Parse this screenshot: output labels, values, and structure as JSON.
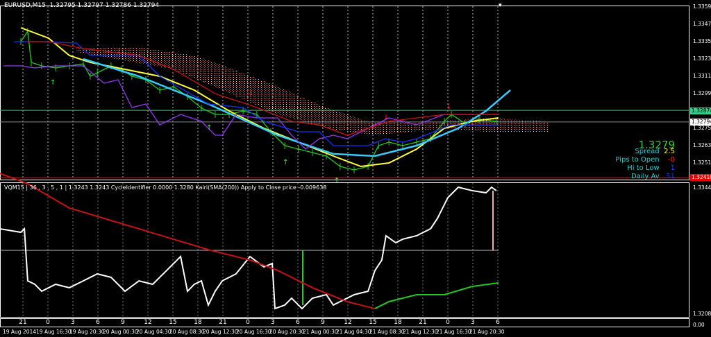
{
  "header": {
    "symbol_tf": "EURUSD,M15",
    "open": "1.32795",
    "high": "1.32797",
    "low": "1.32786",
    "close": "1.32794"
  },
  "subwindow": {
    "title": "VQM15 | 36 , 3 , 5 , 1  |  1.3243 1.3243  CycleIdentifier 0.0000 1.3280  Kairi(SMA(200)) Apply to Close price -0.009638"
  },
  "price_scale": [
    "1.33590",
    "1.33470",
    "1.33350",
    "1.33230",
    "1.33110",
    "1.32990",
    "1.32750",
    "1.32630",
    "1.32510"
  ],
  "price_labels": {
    "green_line": "1.32874",
    "bid": "1.32794",
    "red_line": "1.32410"
  },
  "sub_scale": {
    "top": "1.3344",
    "bottom": "1.3208"
  },
  "bottom_scale": "0.00",
  "info_panel": {
    "price": "1.3279",
    "rows": [
      {
        "label": "Spread",
        "value": "2.5",
        "color": "#ffff33"
      },
      {
        "label": "Pips to Open",
        "value": "-0",
        "color": "#ff2222"
      },
      {
        "label": "Hi to Low",
        "value": "1",
        "color": "#2244ff"
      },
      {
        "label": "Daily Av",
        "value": "51",
        "color": "#2233cc"
      }
    ]
  },
  "hour_labels": [
    "21",
    "0",
    "3",
    "6",
    "9",
    "12",
    "15",
    "18",
    "21",
    "0",
    "3",
    "6",
    "9",
    "12",
    "15",
    "18",
    "21",
    "0",
    "3",
    "6"
  ],
  "date_labels": [
    "19 Aug 2014",
    "19 Aug 16:30",
    "19 Aug 20:30",
    "20 Aug 00:30",
    "20 Aug 04:30",
    "20 Aug 08:30",
    "20 Aug 12:30",
    "20 Aug 16:30",
    "20 Aug 20:30",
    "21 Aug 00:30",
    "21 Aug 04:30",
    "21 Aug 08:30",
    "21 Aug 12:30",
    "21 Aug 16:30",
    "21 Aug 20:30"
  ],
  "chart_data": {
    "type": "line",
    "price_range": [
      1.3238,
      1.336
    ],
    "horizontal_levels": [
      {
        "name": "green-level",
        "price": 1.32874,
        "color": "#33cc66"
      },
      {
        "name": "bid-level",
        "price": 1.32794,
        "color": "#888888"
      },
      {
        "name": "red-level",
        "price": 1.3241,
        "color": "#ff0000"
      }
    ],
    "series": [
      {
        "name": "price",
        "color": "#22cc22",
        "points": [
          [
            10,
            1.3335
          ],
          [
            13.3,
            1.33422
          ],
          [
            15,
            1.33206
          ],
          [
            20,
            1.33182
          ],
          [
            26.7,
            1.33168
          ],
          [
            33.3,
            1.33182
          ],
          [
            40,
            1.33196
          ],
          [
            43.3,
            1.3311
          ],
          [
            46.7,
            1.33134
          ],
          [
            53.3,
            1.33182
          ],
          [
            58.3,
            1.33158
          ],
          [
            63.3,
            1.3311
          ],
          [
            70,
            1.33086
          ],
          [
            76.7,
            1.33014
          ],
          [
            83.3,
            1.33038
          ],
          [
            90,
            1.3297
          ],
          [
            96.7,
            1.3289
          ],
          [
            103.3,
            1.32846
          ],
          [
            110,
            1.32846
          ],
          [
            116.7,
            1.3287
          ],
          [
            123.3,
            1.32846
          ],
          [
            130,
            1.32726
          ],
          [
            136.7,
            1.3263
          ],
          [
            143.3,
            1.32606
          ],
          [
            150,
            1.32582
          ],
          [
            156.7,
            1.32558
          ],
          [
            163.3,
            1.32486
          ],
          [
            170,
            1.32462
          ],
          [
            176.7,
            1.32486
          ],
          [
            181.7,
            1.3263
          ],
          [
            186.7,
            1.32654
          ],
          [
            193.3,
            1.3263
          ],
          [
            200,
            1.32654
          ],
          [
            206.7,
            1.32678
          ],
          [
            213.3,
            1.32798
          ],
          [
            216.7,
            1.32846
          ],
          [
            223.3,
            1.32784
          ],
          [
            230,
            1.32812
          ],
          [
            238.3,
            1.32798
          ]
        ]
      },
      {
        "name": "yellow-ma",
        "color": "#ffff33",
        "points": [
          [
            10,
            1.33446
          ],
          [
            23.3,
            1.33374
          ],
          [
            33.3,
            1.33254
          ],
          [
            43.3,
            1.33206
          ],
          [
            60,
            1.33158
          ],
          [
            76.7,
            1.3311
          ],
          [
            93.3,
            1.33014
          ],
          [
            110,
            1.3287
          ],
          [
            126.7,
            1.3275
          ],
          [
            143.3,
            1.32654
          ],
          [
            160,
            1.32558
          ],
          [
            173.3,
            1.32486
          ],
          [
            186.7,
            1.3251
          ],
          [
            200,
            1.32606
          ],
          [
            213.3,
            1.3275
          ],
          [
            226.7,
            1.32798
          ],
          [
            239.3,
            1.32822
          ]
        ]
      },
      {
        "name": "cyan-curve",
        "color": "#33ccff",
        "points": [
          [
            40,
            1.3323
          ],
          [
            66.7,
            1.3311
          ],
          [
            100,
            1.32918
          ],
          [
            133.3,
            1.32702
          ],
          [
            160,
            1.32573
          ],
          [
            180,
            1.32558
          ],
          [
            200,
            1.3263
          ],
          [
            220,
            1.3275
          ],
          [
            233.3,
            1.3287
          ],
          [
            245,
            1.33014
          ]
        ]
      },
      {
        "name": "purple-line",
        "color": "#9933ff",
        "points": [
          [
            1.7,
            1.33182
          ],
          [
            10,
            1.33182
          ],
          [
            16.7,
            1.33168
          ],
          [
            26.7,
            1.33182
          ],
          [
            40,
            1.33182
          ],
          [
            50,
            1.33062
          ],
          [
            56.7,
            1.33086
          ],
          [
            63.3,
            1.32894
          ],
          [
            70,
            1.32918
          ],
          [
            76.7,
            1.32774
          ],
          [
            86.7,
            1.32846
          ],
          [
            96.7,
            1.32798
          ],
          [
            103.3,
            1.32702
          ],
          [
            106.7,
            1.32702
          ],
          [
            113.3,
            1.32846
          ],
          [
            123.3,
            1.32822
          ],
          [
            133.3,
            1.32822
          ],
          [
            140,
            1.32702
          ],
          [
            146.7,
            1.32606
          ],
          [
            153.3,
            1.32678
          ],
          [
            160,
            1.32702
          ],
          [
            166.7,
            1.32678
          ],
          [
            176.7,
            1.3275
          ],
          [
            186.7,
            1.32822
          ],
          [
            200,
            1.32774
          ],
          [
            213.3,
            1.32846
          ],
          [
            226.7,
            1.32846
          ],
          [
            239.3,
            1.32846
          ]
        ]
      },
      {
        "name": "blue-line",
        "color": "#1133ff",
        "points": [
          [
            6.7,
            1.3335
          ],
          [
            20,
            1.3335
          ],
          [
            36.7,
            1.3334
          ],
          [
            43.3,
            1.33254
          ],
          [
            66.7,
            1.33254
          ],
          [
            76.7,
            1.3311
          ],
          [
            100,
            1.32918
          ],
          [
            116.7,
            1.32894
          ],
          [
            126.7,
            1.32798
          ],
          [
            143.3,
            1.32726
          ],
          [
            153.3,
            1.32726
          ],
          [
            160,
            1.3263
          ],
          [
            176.7,
            1.3263
          ],
          [
            185,
            1.32678
          ],
          [
            193.3,
            1.32654
          ],
          [
            200,
            1.32678
          ],
          [
            216.7,
            1.32774
          ],
          [
            239.3,
            1.32774
          ]
        ]
      },
      {
        "name": "red-line",
        "color": "#cc1111",
        "points": [
          [
            13.3,
            1.3335
          ],
          [
            23.3,
            1.3335
          ],
          [
            40,
            1.33302
          ],
          [
            66.7,
            1.33254
          ],
          [
            83.3,
            1.33158
          ],
          [
            103.3,
            1.3299
          ],
          [
            123.3,
            1.32894
          ],
          [
            140,
            1.32798
          ],
          [
            153.3,
            1.32774
          ],
          [
            166.7,
            1.32702
          ],
          [
            186.7,
            1.32798
          ],
          [
            213.3,
            1.32846
          ],
          [
            239.3,
            1.32846
          ]
        ]
      }
    ],
    "cloud": {
      "top": [
        [
          36.7,
          1.33302
        ],
        [
          66.7,
          1.33312
        ],
        [
          93.3,
          1.33254
        ],
        [
          116.7,
          1.33134
        ],
        [
          133.3,
          1.33038
        ],
        [
          156.7,
          1.32894
        ],
        [
          176.7,
          1.32798
        ],
        [
          200,
          1.32784
        ],
        [
          233.3,
          1.32822
        ],
        [
          263.3,
          1.32798
        ]
      ],
      "bottom": [
        [
          36.7,
          1.33278
        ],
        [
          83.3,
          1.33158
        ],
        [
          106.7,
          1.33014
        ],
        [
          133.3,
          1.32846
        ],
        [
          156.7,
          1.3275
        ],
        [
          180,
          1.32702
        ],
        [
          213.3,
          1.3275
        ],
        [
          233.3,
          1.32726
        ],
        [
          263.3,
          1.32726
        ]
      ]
    },
    "signals": [
      {
        "type": "up",
        "bar": 25,
        "price": 1.3311
      },
      {
        "type": "up",
        "bar": 100,
        "price": 1.32798
      },
      {
        "type": "up",
        "bar": 136.7,
        "price": 1.32558
      },
      {
        "type": "up",
        "bar": 161.3,
        "price": 1.3243
      },
      {
        "type": "down",
        "bar": 56.7,
        "price": 1.33254
      },
      {
        "type": "down",
        "bar": 120,
        "price": 1.32966
      },
      {
        "type": "down",
        "bar": 185,
        "price": 1.32798
      },
      {
        "type": "down",
        "bar": 215,
        "price": 1.3287
      }
    ],
    "sub": {
      "range": [
        1.3208,
        1.3344
      ],
      "level": 1.3276,
      "series": [
        {
          "name": "vqm-white",
          "color": "#ffffff",
          "points": [
            [
              0,
              1.32992
            ],
            [
              10,
              1.32954
            ],
            [
              11.7,
              1.32992
            ],
            [
              13.3,
              1.32431
            ],
            [
              16.7,
              1.32394
            ],
            [
              20,
              1.32319
            ],
            [
              26.7,
              1.32394
            ],
            [
              33.3,
              1.32357
            ],
            [
              40,
              1.32431
            ],
            [
              46.7,
              1.32506
            ],
            [
              53.3,
              1.32469
            ],
            [
              60,
              1.32319
            ],
            [
              66.7,
              1.32431
            ],
            [
              73.3,
              1.32394
            ],
            [
              80,
              1.32543
            ],
            [
              86.7,
              1.32693
            ],
            [
              90,
              1.32319
            ],
            [
              93.3,
              1.32394
            ],
            [
              96.7,
              1.32431
            ],
            [
              100,
              1.3217
            ],
            [
              103.3,
              1.32319
            ],
            [
              106.7,
              1.32431
            ],
            [
              113.3,
              1.32506
            ],
            [
              120,
              1.32693
            ],
            [
              126.7,
              1.32581
            ],
            [
              130.7,
              1.32618
            ],
            [
              132,
              1.32132
            ],
            [
              136.7,
              1.3217
            ],
            [
              140,
              1.32244
            ],
            [
              145,
              1.32132
            ],
            [
              146.7,
              1.3217
            ],
            [
              150,
              1.32244
            ],
            [
              156.7,
              1.32282
            ],
            [
              160,
              1.3217
            ],
            [
              163.3,
              1.32207
            ],
            [
              170,
              1.32282
            ],
            [
              176.7,
              1.32319
            ],
            [
              180,
              1.32543
            ],
            [
              183.3,
              1.32655
            ],
            [
              185.3,
              1.32917
            ],
            [
              190,
              1.32842
            ],
            [
              193.3,
              1.3288
            ],
            [
              200,
              1.32917
            ],
            [
              206.7,
              1.32992
            ],
            [
              210,
              1.33104
            ],
            [
              215,
              1.33328
            ],
            [
              220,
              1.3344
            ],
            [
              226.7,
              1.33403
            ],
            [
              233.3,
              1.3338
            ],
            [
              236,
              1.3344
            ],
            [
              238.3,
              1.33403
            ]
          ]
        },
        {
          "name": "cycle-red",
          "color": "#cc1111",
          "points": [
            [
              0,
              1.33589
            ],
            [
              13.3,
              1.33477
            ],
            [
              33.3,
              1.33216
            ],
            [
              66.7,
              1.32992
            ],
            [
              100,
              1.32767
            ],
            [
              120,
              1.32655
            ],
            [
              133.3,
              1.32543
            ],
            [
              150,
              1.32357
            ],
            [
              166.7,
              1.32207
            ],
            [
              180,
              1.32132
            ]
          ]
        },
        {
          "name": "cycle-green",
          "color": "#22cc22",
          "points": [
            [
              180,
              1.32132
            ],
            [
              186.7,
              1.32207
            ],
            [
              200,
              1.32282
            ],
            [
              213.3,
              1.32282
            ],
            [
              226.7,
              1.32371
            ],
            [
              239.3,
              1.32409
            ]
          ]
        }
      ]
    }
  }
}
